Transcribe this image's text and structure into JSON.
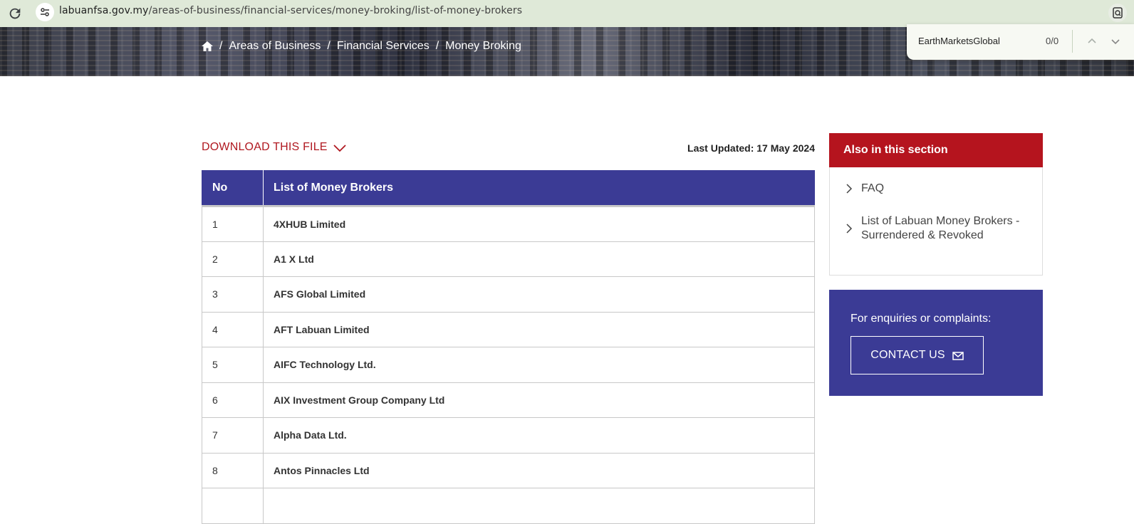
{
  "browser": {
    "url_host": "labuanfsa.gov.my",
    "url_path": "/areas-of-business/financial-services/money-broking/list-of-money-brokers"
  },
  "breadcrumb": [
    "Areas of Business",
    "Financial Services",
    "Money Broking"
  ],
  "find_bar": {
    "query": "EarthMarketsGlobal",
    "count": "0/0"
  },
  "download_label": "DOWNLOAD THIS FILE",
  "last_updated": "Last Updated: 17 May 2024",
  "table": {
    "headers": [
      "No",
      "List of Money Brokers"
    ],
    "rows": [
      {
        "no": "1",
        "name": "4XHUB Limited"
      },
      {
        "no": "2",
        "name": "A1 X Ltd"
      },
      {
        "no": "3",
        "name": "AFS Global Limited"
      },
      {
        "no": "4",
        "name": "AFT Labuan Limited"
      },
      {
        "no": "5",
        "name": "AIFC Technology Ltd."
      },
      {
        "no": "6",
        "name": "AIX Investment Group Company Ltd"
      },
      {
        "no": "7",
        "name": "Alpha Data Ltd."
      },
      {
        "no": "8",
        "name": "Antos Pinnacles Ltd"
      },
      {
        "no": "",
        "name": ""
      }
    ]
  },
  "sidebar": {
    "heading": "Also in this section",
    "links": [
      "FAQ",
      "List of Labuan Money Brokers - Surrendered & Revoked"
    ],
    "enquiry_text": "For enquiries or complaints:",
    "contact_label": "CONTACT US"
  },
  "colors": {
    "brand_red": "#b5141e",
    "brand_blue": "#3b3b95",
    "download_red": "#b01820"
  }
}
